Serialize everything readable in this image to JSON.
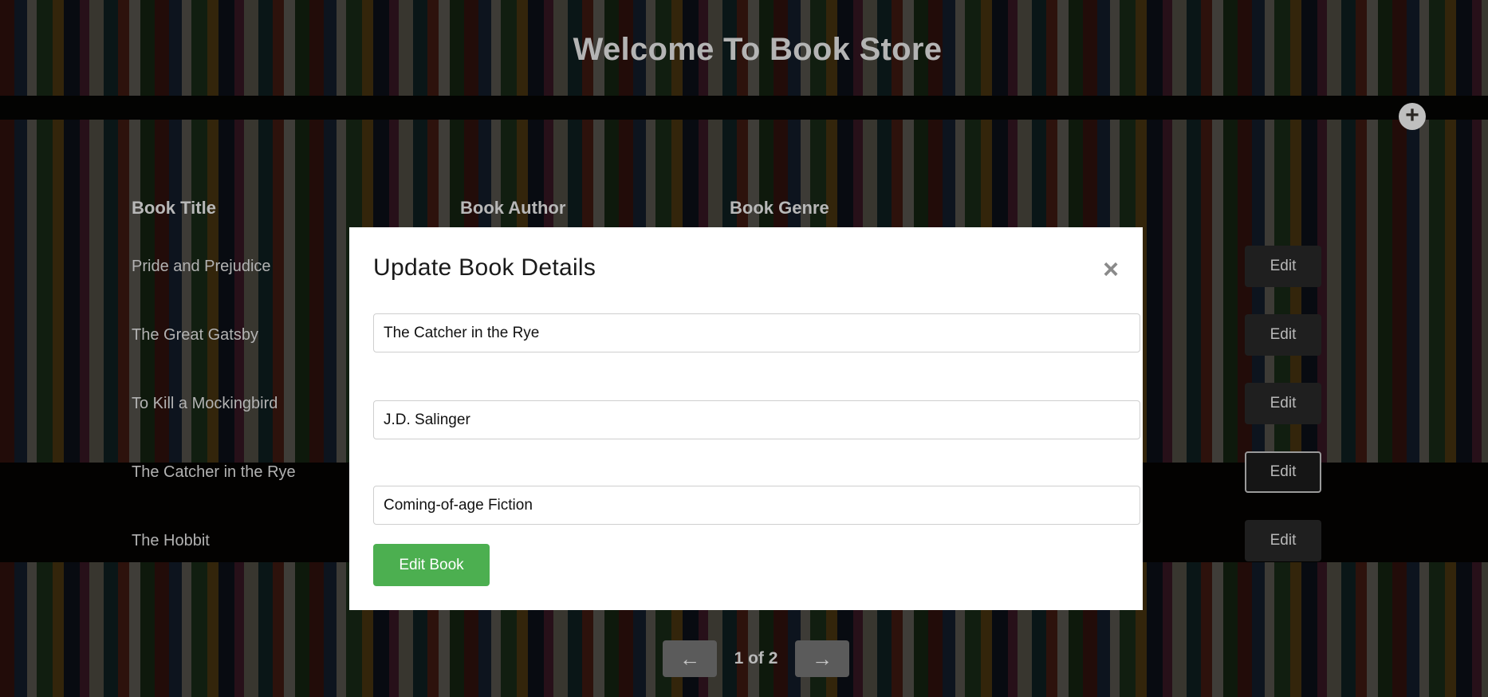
{
  "header": {
    "title": "Welcome To Book Store",
    "add_icon": "plus-circle-icon"
  },
  "table": {
    "columns": [
      "Book Title",
      "Book Author",
      "Book Genre"
    ],
    "rows": [
      {
        "title": "Pride and Prejudice",
        "edit_label": "Edit"
      },
      {
        "title": "The Great Gatsby",
        "edit_label": "Edit"
      },
      {
        "title": "To Kill a Mockingbird",
        "edit_label": "Edit"
      },
      {
        "title": "The Catcher in the Rye",
        "edit_label": "Edit"
      },
      {
        "title": "The Hobbit",
        "edit_label": "Edit"
      }
    ]
  },
  "pagination": {
    "prev_icon": "arrow-left-icon",
    "next_icon": "arrow-right-icon",
    "page_info": "1 of 2"
  },
  "modal": {
    "title": "Update Book Details",
    "close_icon": "close-icon",
    "fields": {
      "title_value": "The Catcher in the Rye",
      "author_value": "J.D. Salinger",
      "genre_value": "Coming-of-age Fiction"
    },
    "submit_label": "Edit Book"
  },
  "colors": {
    "accent_green": "#4caf50",
    "overlay": "#000000",
    "modal_bg": "#ffffff"
  }
}
